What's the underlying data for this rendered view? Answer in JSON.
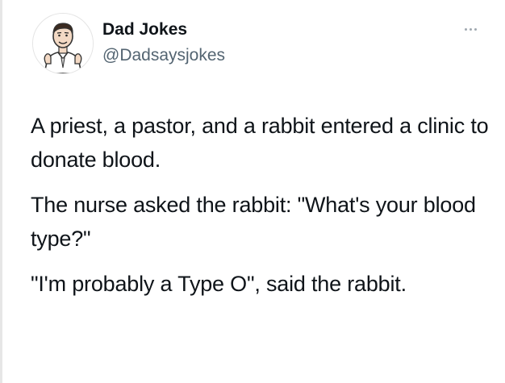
{
  "author": {
    "name": "Dad Jokes",
    "handle": "@Dadsaysjokes",
    "avatar_icon": "cartoon-dad-avatar"
  },
  "menu": {
    "icon": "more-horizontal-icon"
  },
  "tweet": {
    "paragraphs": [
      "A priest, a pastor, and a rabbit entered a clinic to donate blood.",
      "The nurse asked the rabbit: \"What's your blood type?\"",
      "\"I'm probably a Type O\", said the rabbit."
    ]
  },
  "colors": {
    "text": "#0f1419",
    "secondary_text": "#536471",
    "background": "#ffffff"
  }
}
